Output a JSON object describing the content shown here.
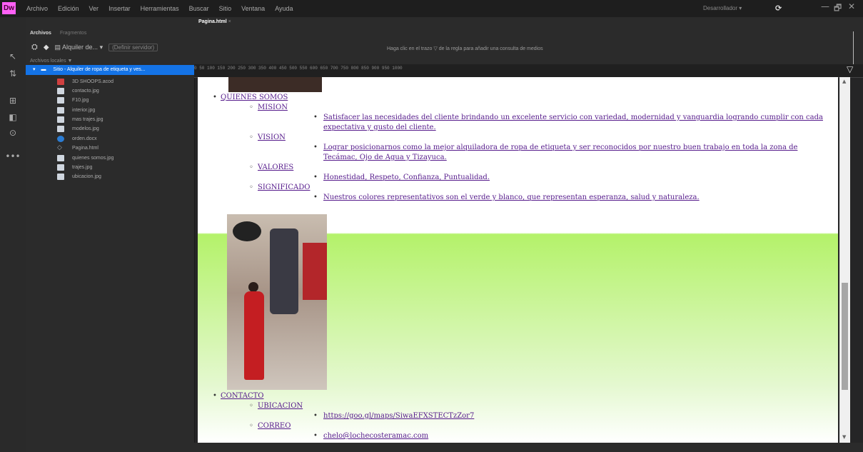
{
  "app": {
    "logo": "Dw",
    "menus": [
      "Archivo",
      "Edición",
      "Ver",
      "Insertar",
      "Herramientas",
      "Buscar",
      "Sitio",
      "Ventana",
      "Ayuda"
    ],
    "mode": "Desarrollador ▾",
    "sync_icon": "sync-icon",
    "win": {
      "minimize": "—",
      "restore": "🗗",
      "close": "✕"
    }
  },
  "files_panel": {
    "tabs": [
      "Archivos",
      "Fragmentos"
    ],
    "site": "Alquiler de...",
    "env": "(Definir servidor)",
    "local_label": "Archivos locales ▼",
    "root": "Sitio - Alquiler de ropa de etiqueta y ves...",
    "files": [
      {
        "name": "3D SHOOPS.acod",
        "icon": "folder-icon",
        "color": "#d04040"
      },
      {
        "name": "contacto.jpg",
        "icon": "image-icon",
        "color": "#cfd6df"
      },
      {
        "name": "F10.jpg",
        "icon": "image-icon",
        "color": "#cfd6df"
      },
      {
        "name": "interior.jpg",
        "icon": "image-icon",
        "color": "#cfd6df"
      },
      {
        "name": "mas trajes.jpg",
        "icon": "image-icon",
        "color": "#cfd6df"
      },
      {
        "name": "modelos.jpg",
        "icon": "image-icon",
        "color": "#cfd6df"
      },
      {
        "name": "orden.docx",
        "icon": "word-icon",
        "color": "#2b7cd3"
      },
      {
        "name": "Pagina.html",
        "icon": "code-icon",
        "color": "#9aa4ad"
      },
      {
        "name": "quienes somos.jpg",
        "icon": "image-icon",
        "color": "#cfd6df"
      },
      {
        "name": "trajes.jpg",
        "icon": "image-icon",
        "color": "#cfd6df"
      },
      {
        "name": "ubicacion.jpg",
        "icon": "image-icon",
        "color": "#cfd6df"
      }
    ]
  },
  "document": {
    "tab": "Pagina.html",
    "mq_hint": "Haga clic en el trazo  ▽  de la regla para añadir una consulta de medios",
    "ruler_text": "0      50      100      150      200      250      300      350      400      450      500      550      600      650      700      750      800      850      900      950     1000"
  },
  "page": {
    "quienes": {
      "label": "QUIENES SOMOS",
      "mision": {
        "label": "MISION",
        "text": "Satisfacer las necesidades del cliente brindando un excelente servicio con variedad, modernidad y vanguardia logrando cumplir con cada expectativa y gusto del cliente."
      },
      "vision": {
        "label": "VISION",
        "text": "Lograr posicionarnos como la mejor alquiladora de ropa de etiqueta y ser reconocidos por nuestro buen trabajo en toda la zona de Tecámac, Ojo de Agua y Tizayuca."
      },
      "valores": {
        "label": "VALORES",
        "text": "Honestidad, Respeto, Confianza, Puntualidad."
      },
      "significado": {
        "label": "SIGNIFICADO",
        "text": "Nuestros colores representativos son el verde y blanco, que representan esperanza, salud y naturaleza."
      }
    },
    "contacto": {
      "label": "CONTACTO",
      "ubicacion": {
        "label": "UBICACION",
        "url": "https://goo.gl/maps/SiwaEFXSTECTzZor7"
      },
      "correo": {
        "label": "CORREO",
        "email": "chelo@lochecosteramac.com"
      }
    }
  }
}
